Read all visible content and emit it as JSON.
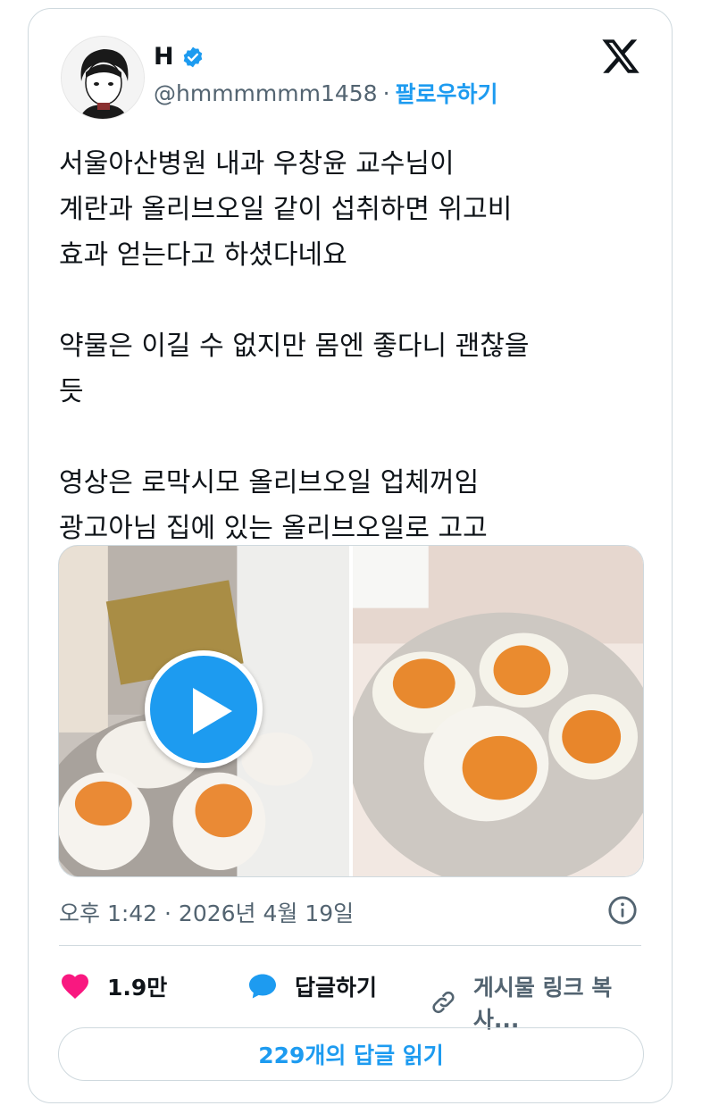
{
  "user": {
    "name": "H",
    "handle": "@hmmmmmm1458",
    "separator": "·",
    "follow_label": "팔로우하기"
  },
  "tweet": {
    "text": "서울아산병원 내과 우창윤 교수님이\n계란과 올리브오일 같이 섭취하면 위고비\n효과 얻는다고 하셨다네요\n\n약물은 이길 수 없지만 몸엔 좋다니 괜찮을\n듯\n\n영상은 로막시모 올리브오일 업체꺼임\n광고아님 집에 있는 올리브오일로 고고",
    "timestamp": "오후 1:42 · 2026년 4월 19일"
  },
  "actions": {
    "like_count": "1.9만",
    "reply_label": "답글하기",
    "copy_link_label": "게시물 링크 복사..."
  },
  "read_replies_label": "229개의 답글 읽기",
  "icons": {
    "verified": "verified-badge-icon",
    "logo": "x-logo-icon",
    "play": "play-icon",
    "info": "info-icon",
    "like": "heart-icon",
    "reply": "speech-bubble-icon",
    "link": "link-icon"
  },
  "colors": {
    "accent": "#1d9bf0",
    "like": "#f91880",
    "text_secondary": "#536471",
    "border": "#cfd9de"
  }
}
